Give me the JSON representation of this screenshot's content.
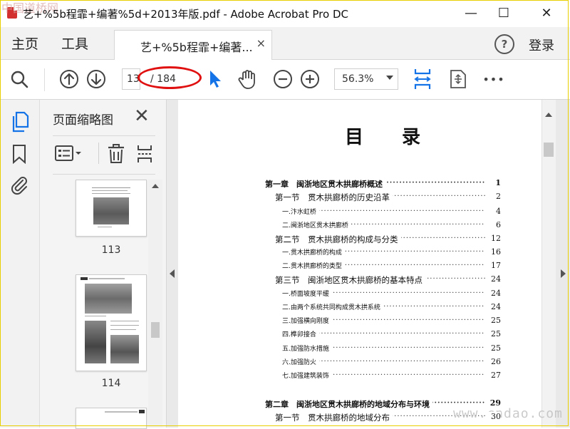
{
  "window": {
    "title": "艺+%5b程霏+编著%5d+2013年版.pdf - Adobe Acrobat Pro DC",
    "watermark_top": "中国道桥网",
    "minimize": "—",
    "maximize": "☐",
    "close": "✕"
  },
  "menu": {
    "home": "主页",
    "tools": "工具",
    "tab_title": "艺+%5b程霏+编著...",
    "tab_close": "×",
    "help": "?",
    "login": "登录"
  },
  "toolbar": {
    "current_page": "13",
    "page_total": "/ 184",
    "zoom": "56.3%",
    "more": "•••"
  },
  "thumbnails": {
    "panel_title": "页面缩略图",
    "close": "✕",
    "pages": [
      {
        "label": "113"
      },
      {
        "label": "114"
      }
    ]
  },
  "document": {
    "heading": "目录",
    "toc": [
      {
        "text": "第一章　闽浙地区贯木拱廊桥概述",
        "page": "1",
        "level": 0
      },
      {
        "text": "第一节　贯木拱廊桥的历史沿革",
        "page": "2",
        "level": 1
      },
      {
        "text": "一.汴水虹桥",
        "page": "4",
        "level": 2
      },
      {
        "text": "二.闽浙地区贯木拱廊桥",
        "page": "6",
        "level": 2
      },
      {
        "text": "第二节　贯木拱廊桥的构成与分类",
        "page": "12",
        "level": 1
      },
      {
        "text": "一.贯木拱廊桥的构成",
        "page": "16",
        "level": 2
      },
      {
        "text": "二.贯木拱廊桥的类型",
        "page": "17",
        "level": 2
      },
      {
        "text": "第三节　闽浙地区贯木拱廊桥的基本特点",
        "page": "24",
        "level": 1
      },
      {
        "text": "一.桥面坡度平缓",
        "page": "24",
        "level": 2
      },
      {
        "text": "二.由两个系统共同构成贯木拱系统",
        "page": "24",
        "level": 2
      },
      {
        "text": "三.加强横向刚度",
        "page": "25",
        "level": 2
      },
      {
        "text": "四.榫卯接合",
        "page": "25",
        "level": 2
      },
      {
        "text": "五.加强防水措施",
        "page": "25",
        "level": 2
      },
      {
        "text": "六.加强防火",
        "page": "26",
        "level": 2
      },
      {
        "text": "七.加强建筑装饰",
        "page": "27",
        "level": 2
      },
      {
        "text": "第二章　闽浙地区贯木拱廊桥的地域分布与环境",
        "page": "29",
        "level": 0
      },
      {
        "text": "第一节　贯木拱廊桥的地域分布",
        "page": "30",
        "level": 1
      }
    ],
    "watermark": "www.cndao.com"
  },
  "colors": {
    "accent": "#1473e6",
    "highlight": "#e01010"
  }
}
